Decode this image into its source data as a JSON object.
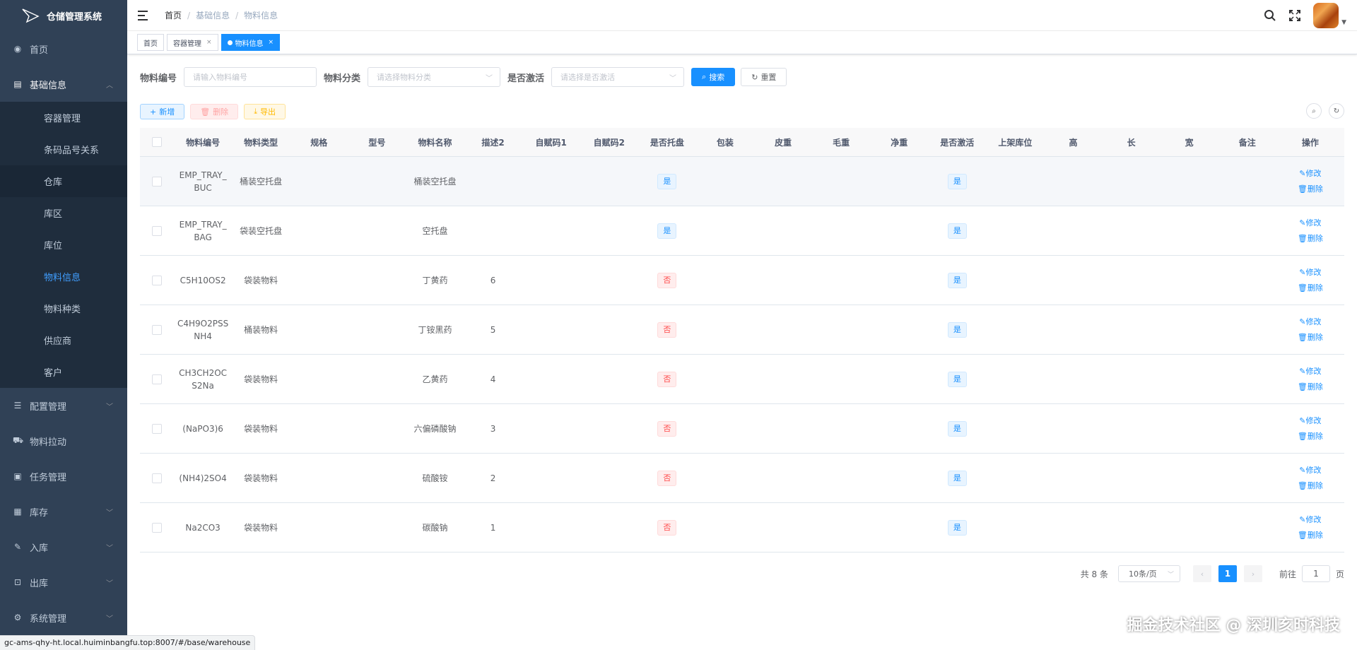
{
  "app": {
    "title": "仓储管理系统"
  },
  "sidebar": {
    "items": [
      {
        "label": "首页",
        "icon": "dashboard-icon"
      },
      {
        "label": "基础信息",
        "icon": "document-icon",
        "expanded": true
      },
      {
        "label": "配置管理",
        "icon": "sliders-icon"
      },
      {
        "label": "物料拉动",
        "icon": "cart-icon"
      },
      {
        "label": "任务管理",
        "icon": "task-icon"
      },
      {
        "label": "库存",
        "icon": "grid-icon"
      },
      {
        "label": "入库",
        "icon": "edit-icon"
      },
      {
        "label": "出库",
        "icon": "box-icon"
      },
      {
        "label": "系统管理",
        "icon": "gear-icon"
      }
    ],
    "sub_items": [
      "容器管理",
      "条码品号关系",
      "仓库",
      "库区",
      "库位",
      "物料信息",
      "物料种类",
      "供应商",
      "客户"
    ],
    "active_sub": "物料信息"
  },
  "breadcrumb": [
    "首页",
    "基础信息",
    "物料信息"
  ],
  "tags": [
    "首页",
    "容器管理",
    "物料信息"
  ],
  "search": {
    "code_label": "物料编号",
    "code_placeholder": "请输入物料编号",
    "category_label": "物料分类",
    "category_placeholder": "请选择物料分类",
    "active_label": "是否激活",
    "active_placeholder": "请选择是否激活",
    "search_button": "搜索",
    "reset_button": "重置"
  },
  "toolbar": {
    "add": "新增",
    "delete": "删除",
    "export": "导出"
  },
  "table": {
    "columns": [
      "物料编号",
      "物料类型",
      "规格",
      "型号",
      "物料名称",
      "描述2",
      "自赋码1",
      "自赋码2",
      "是否托盘",
      "包装",
      "皮重",
      "毛重",
      "净重",
      "是否激活",
      "上架库位",
      "高",
      "长",
      "宽",
      "备注",
      "操作"
    ],
    "rows": [
      {
        "code": "EMP_TRAY_BUC",
        "type": "桶装空托盘",
        "name": "桶装空托盘",
        "desc2": "",
        "tray": "是",
        "active": "是"
      },
      {
        "code": "EMP_TRAY_BAG",
        "type": "袋装空托盘",
        "name": "空托盘",
        "desc2": "",
        "tray": "是",
        "active": "是"
      },
      {
        "code": "C5H10OS2",
        "type": "袋装物料",
        "name": "丁黄药",
        "desc2": "6",
        "tray": "否",
        "active": "是"
      },
      {
        "code": "C4H9O2PSSNH4",
        "type": "桶装物料",
        "name": "丁铵黑药",
        "desc2": "5",
        "tray": "否",
        "active": "是"
      },
      {
        "code": "CH3CH2OCS2Na",
        "type": "袋装物料",
        "name": "乙黄药",
        "desc2": "4",
        "tray": "否",
        "active": "是"
      },
      {
        "code": "(NaPO3)6",
        "type": "袋装物料",
        "name": "六偏磷酸钠",
        "desc2": "3",
        "tray": "否",
        "active": "是"
      },
      {
        "code": "(NH4)2SO4",
        "type": "袋装物料",
        "name": "硫酸铵",
        "desc2": "2",
        "tray": "否",
        "active": "是"
      },
      {
        "code": "Na2CO3",
        "type": "袋装物料",
        "name": "碳酸钠",
        "desc2": "1",
        "tray": "否",
        "active": "是"
      }
    ],
    "edit_label": "修改",
    "delete_label": "删除"
  },
  "pagination": {
    "total": "共 8 条",
    "page_size": "10条/页",
    "current": "1",
    "goto_label": "前往",
    "goto_value": "1",
    "page_suffix": "页"
  },
  "watermark": "掘金技术社区 @ 深圳亥时科技",
  "status_url": "gc-ams-qhy-ht.local.huiminbangfu.top:8007/#/base/warehouse",
  "colors": {
    "sidebar_bg": "#304156",
    "sidebar_sub_bg": "#1f2d3d",
    "primary": "#1890ff",
    "danger": "#ff4949"
  }
}
